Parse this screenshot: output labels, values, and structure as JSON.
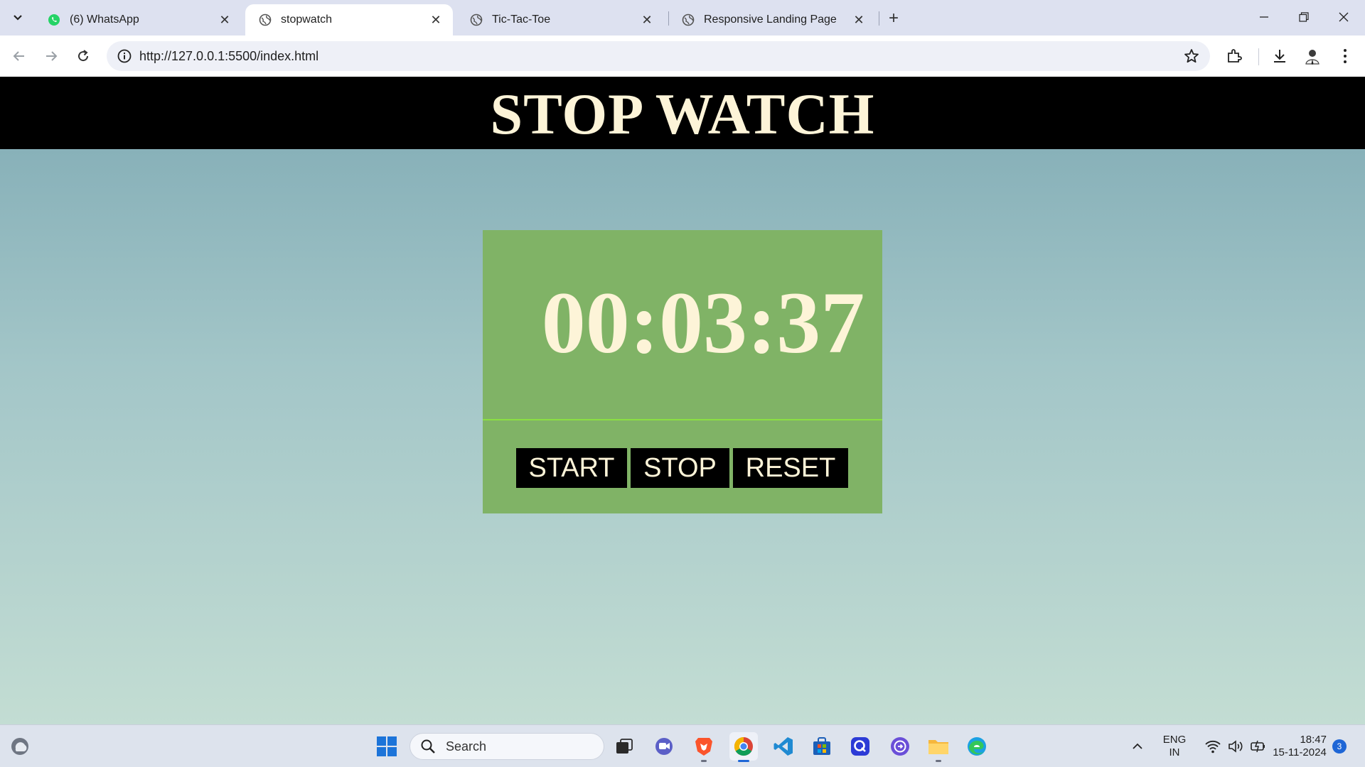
{
  "browser": {
    "tabs": [
      {
        "title": "(6) WhatsApp",
        "favicon": "whatsapp-icon",
        "active": false
      },
      {
        "title": "stopwatch",
        "favicon": "globe-icon",
        "active": true
      },
      {
        "title": "Tic-Tac-Toe",
        "favicon": "globe-icon",
        "active": false
      },
      {
        "title": "Responsive Landing Page",
        "favicon": "globe-icon",
        "active": false
      }
    ],
    "url": "http://127.0.0.1:5500/index.html"
  },
  "page": {
    "title": "STOP WATCH",
    "time": "00:03:37",
    "buttons": {
      "start": "START",
      "stop": "STOP",
      "reset": "RESET"
    }
  },
  "taskbar": {
    "search_placeholder": "Search",
    "language_line1": "ENG",
    "language_line2": "IN",
    "clock_time": "18:47",
    "clock_date": "15-11-2024",
    "notification_count": "3"
  },
  "colors": {
    "header_bg": "#000000",
    "title_text": "#fdf4d8",
    "watch_bg": "#80b366",
    "divider": "#8be042",
    "button_bg": "#000000",
    "page_gradient_top": "#7faab4",
    "page_gradient_bottom": "#c3ddd3"
  }
}
